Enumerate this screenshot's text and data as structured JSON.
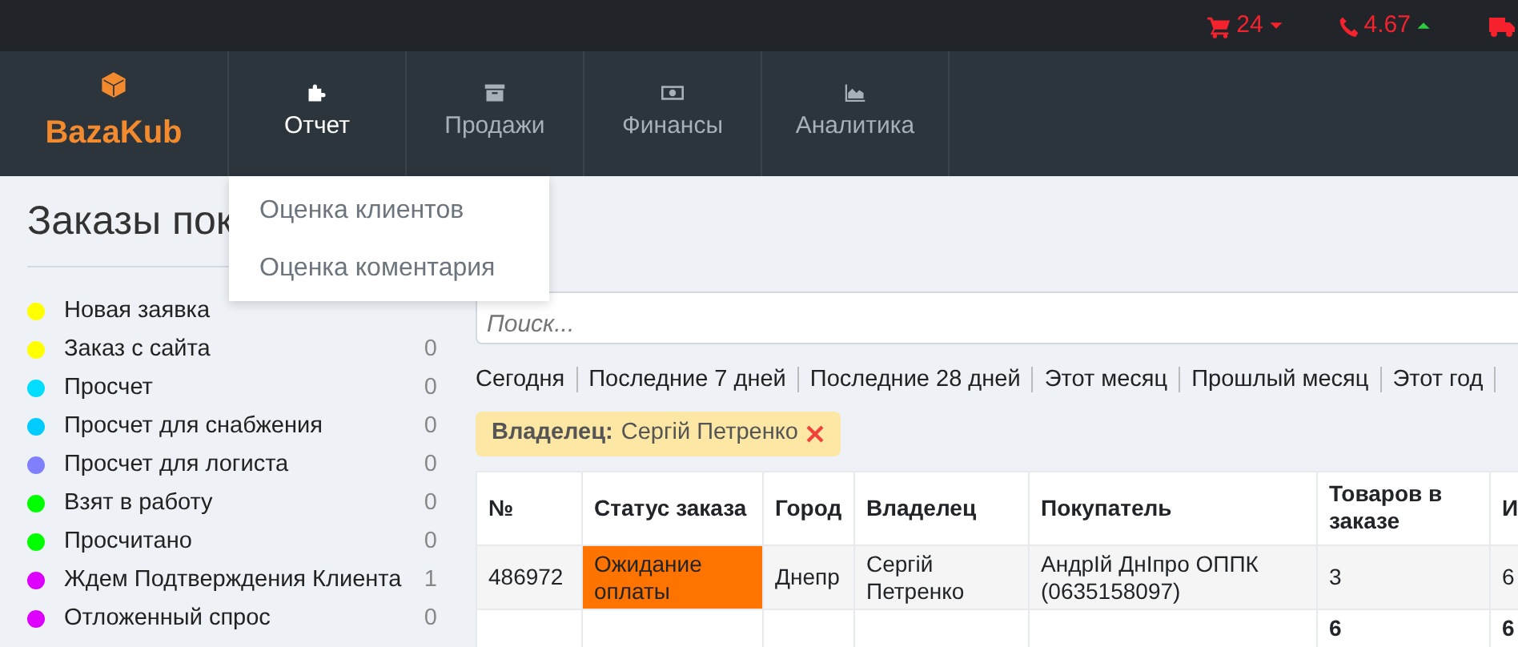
{
  "top_bar": {
    "indicators": [
      {
        "kind": "cart",
        "value": "24",
        "rising": false
      },
      {
        "kind": "phone",
        "value": "4.67",
        "rising": true
      },
      {
        "kind": "truck"
      }
    ]
  },
  "brand": {
    "name": "BazaKub"
  },
  "nav": [
    {
      "label": "Отчет",
      "kind": "puzzle",
      "selected": true
    },
    {
      "label": "Продажи",
      "kind": "archive",
      "selected": false
    },
    {
      "label": "Финансы",
      "kind": "money",
      "selected": false
    },
    {
      "label": "Аналитика",
      "kind": "chart",
      "selected": false
    }
  ],
  "dropdown": {
    "items": [
      "Оценка клиентов",
      "Оценка коментария"
    ]
  },
  "page_title": "Заказы пок",
  "statuses": [
    {
      "label": "Новая заявка",
      "color": "#ffff00"
    },
    {
      "label": "Заказ с сайта",
      "count": "0",
      "color": "#ffff00"
    },
    {
      "label": "Просчет",
      "count": "0",
      "color": "#00ddff"
    },
    {
      "label": "Просчет для снабжения",
      "count": "0",
      "color": "#00ccff"
    },
    {
      "label": "Просчет для логиста",
      "count": "0",
      "color": "#8080ff"
    },
    {
      "label": "Взят в работу",
      "count": "0",
      "color": "#00ff00"
    },
    {
      "label": "Просчитано",
      "count": "0",
      "color": "#00ff00"
    },
    {
      "label": "Ждем Подтверждения Клиента",
      "count": "1",
      "color": "#dd00ff"
    },
    {
      "label": "Отложенный спрос",
      "count": "0",
      "color": "#dd00ff"
    }
  ],
  "search": {
    "placeholder": "Поиск..."
  },
  "date_filters": [
    "Сегодня",
    "Последние 7 дней",
    "Последние 28 дней",
    "Этот месяц",
    "Прошлый месяц",
    "Этот год"
  ],
  "active_filter": {
    "label": "Владелец:",
    "value": "Сергій Петренко"
  },
  "table": {
    "columns": [
      "№",
      "Статус заказа",
      "Город",
      "Владелец",
      "Покупатель",
      "Товаров в заказе",
      "И"
    ],
    "rows": [
      {
        "cells": [
          "486972",
          "Ожидание оплаты",
          "Днепр",
          "Сергій Петренко",
          "АндрІй ДнІпро ОППК (0635158097)",
          "3",
          "6"
        ],
        "color": "#ff7300"
      }
    ],
    "totals": [
      "6",
      "6"
    ]
  }
}
